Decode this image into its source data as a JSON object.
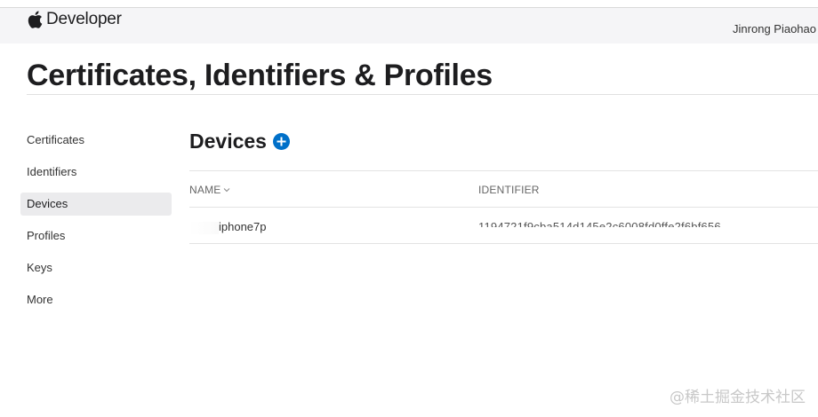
{
  "header": {
    "brand": "Developer",
    "user": "Jinrong Piaohao"
  },
  "page": {
    "title": "Certificates, Identifiers & Profiles"
  },
  "sidebar": {
    "items": [
      {
        "label": "Certificates"
      },
      {
        "label": "Identifiers"
      },
      {
        "label": "Devices"
      },
      {
        "label": "Profiles"
      },
      {
        "label": "Keys"
      },
      {
        "label": "More"
      }
    ],
    "active": "Devices"
  },
  "devices": {
    "title": "Devices",
    "columns": {
      "name": "NAME",
      "identifier": "IDENTIFIER"
    },
    "rows": [
      {
        "name": "iphone7p",
        "identifier": "1194721f9cba514d145e2c6008fd0ffe2f6bf656"
      }
    ]
  },
  "watermark": "@稀土掘金技术社区",
  "colors": {
    "accent": "#0070c9",
    "active_bg": "#ebebed",
    "header_bg": "#f5f5f7"
  }
}
